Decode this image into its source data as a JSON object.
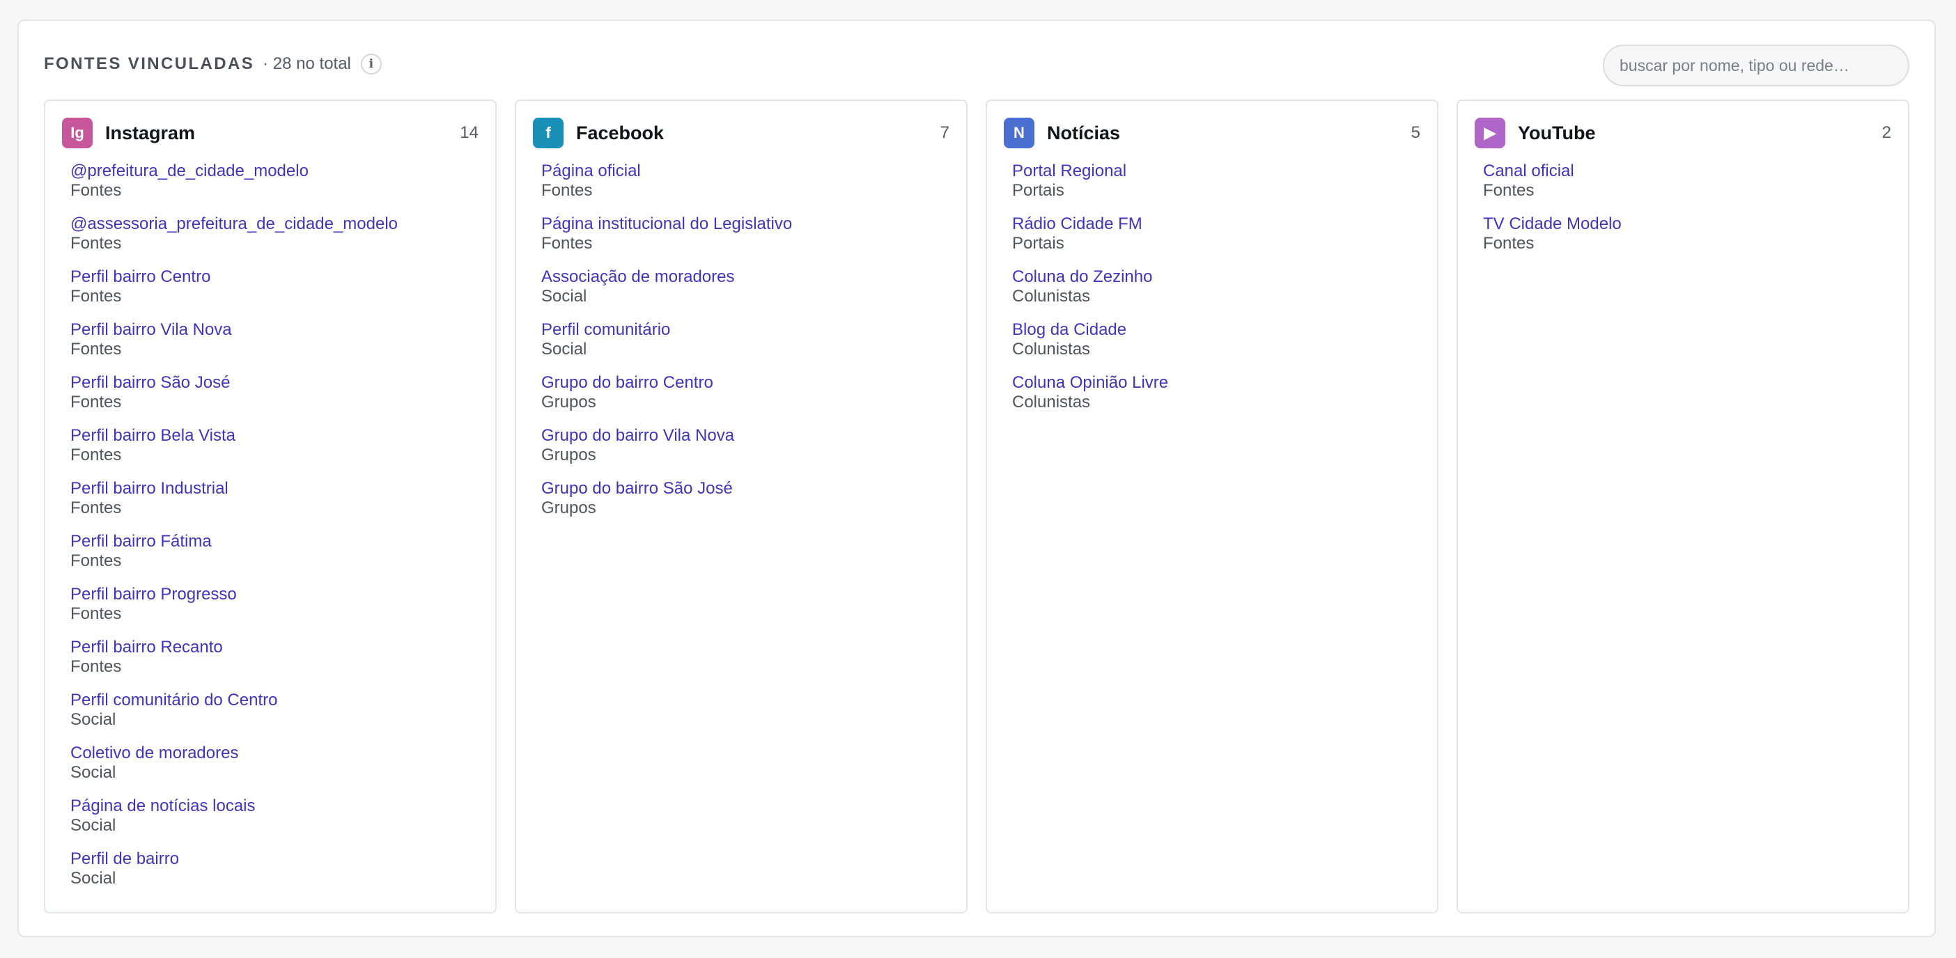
{
  "header": {
    "title": "FONTES VINCULADAS",
    "total": "· 28 no total",
    "info_glyph": "i",
    "search_placeholder": "buscar por nome, tipo ou rede…"
  },
  "columns": [
    {
      "key": "instagram",
      "name": "Instagram",
      "count": "14",
      "icon_glyph": "Ig",
      "icon_name": "instagram-icon",
      "color": "#c8569a",
      "items": [
        {
          "name": "@prefeitura_de_cidade_modelo",
          "type": "Fontes"
        },
        {
          "name": "@assessoria_prefeitura_de_cidade_modelo",
          "type": "Fontes"
        },
        {
          "name": "Perfil bairro Centro",
          "type": "Fontes"
        },
        {
          "name": "Perfil bairro Vila Nova",
          "type": "Fontes"
        },
        {
          "name": "Perfil bairro São José",
          "type": "Fontes"
        },
        {
          "name": "Perfil bairro Bela Vista",
          "type": "Fontes"
        },
        {
          "name": "Perfil bairro Industrial",
          "type": "Fontes"
        },
        {
          "name": "Perfil bairro Fátima",
          "type": "Fontes"
        },
        {
          "name": "Perfil bairro Progresso",
          "type": "Fontes"
        },
        {
          "name": "Perfil bairro Recanto",
          "type": "Fontes"
        },
        {
          "name": "Perfil comunitário do Centro",
          "type": "Social"
        },
        {
          "name": "Coletivo de moradores",
          "type": "Social"
        },
        {
          "name": "Página de notícias locais",
          "type": "Social"
        },
        {
          "name": "Perfil de bairro",
          "type": "Social"
        }
      ]
    },
    {
      "key": "facebook",
      "name": "Facebook",
      "count": "7",
      "icon_glyph": "f",
      "icon_name": "facebook-icon",
      "color": "#1a90b8",
      "items": [
        {
          "name": "Página oficial",
          "type": "Fontes"
        },
        {
          "name": "Página institucional do Legislativo",
          "type": "Fontes"
        },
        {
          "name": "Associação de moradores",
          "type": "Social"
        },
        {
          "name": "Perfil comunitário",
          "type": "Social"
        },
        {
          "name": "Grupo do bairro Centro",
          "type": "Grupos"
        },
        {
          "name": "Grupo do bairro Vila Nova",
          "type": "Grupos"
        },
        {
          "name": "Grupo do bairro São José",
          "type": "Grupos"
        }
      ]
    },
    {
      "key": "noticias",
      "name": "Notícias",
      "count": "5",
      "icon_glyph": "N",
      "icon_name": "news-icon",
      "color": "#4a6fd0",
      "items": [
        {
          "name": "Portal Regional",
          "type": "Portais"
        },
        {
          "name": "Rádio Cidade FM",
          "type": "Portais"
        },
        {
          "name": "Coluna do Zezinho",
          "type": "Colunistas"
        },
        {
          "name": "Blog da Cidade",
          "type": "Colunistas"
        },
        {
          "name": "Coluna Opinião Livre",
          "type": "Colunistas"
        }
      ]
    },
    {
      "key": "youtube",
      "name": "YouTube",
      "count": "2",
      "icon_glyph": "▶",
      "icon_name": "youtube-play-icon",
      "color": "#b066c8",
      "items": [
        {
          "name": "Canal oficial",
          "type": "Fontes"
        },
        {
          "name": "TV Cidade Modelo",
          "type": "Fontes"
        }
      ]
    }
  ]
}
